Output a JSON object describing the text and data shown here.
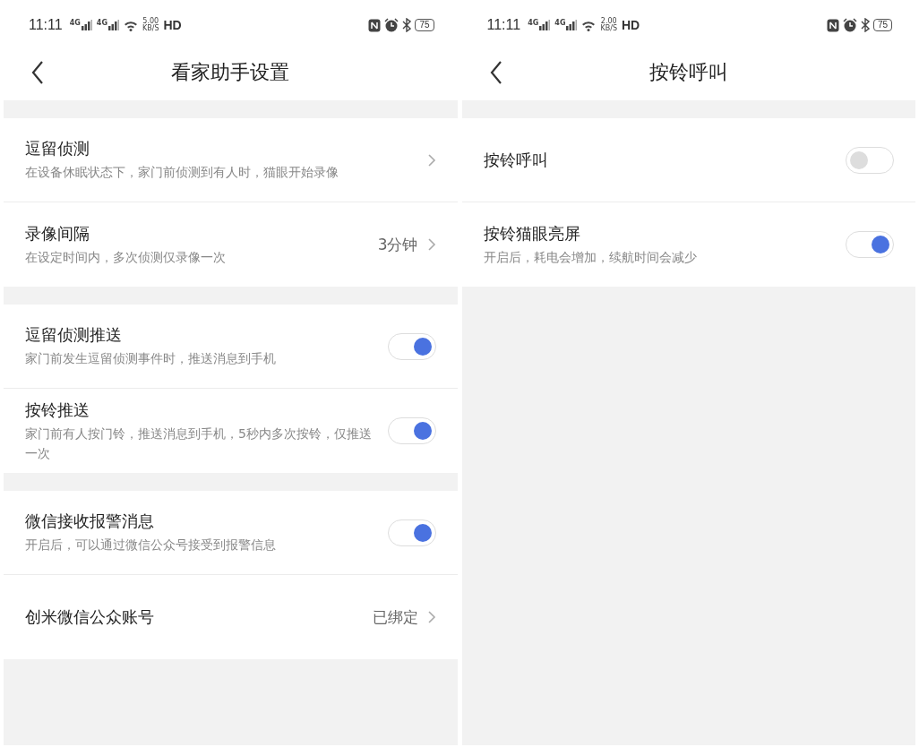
{
  "screens": [
    {
      "status_bar": {
        "time": "11:11",
        "signal_1": "4G",
        "signal_2": "4G",
        "speed": "5.00",
        "speed_unit": "KB/S",
        "hd": "HD",
        "battery": "75"
      },
      "title": "看家助手设置",
      "sections": [
        {
          "rows": [
            {
              "kind": "nav",
              "title": "逗留侦测",
              "subtitle": "在设备休眠状态下，家门前侦测到有人时，猫眼开始录像"
            },
            {
              "kind": "nav",
              "title": "录像间隔",
              "subtitle": "在设定时间内，多次侦测仅录像一次",
              "value": "3分钟"
            }
          ]
        },
        {
          "rows": [
            {
              "kind": "toggle",
              "title": "逗留侦测推送",
              "subtitle": "家门前发生逗留侦测事件时，推送消息到手机",
              "on": true
            },
            {
              "kind": "toggle",
              "title": "按铃推送",
              "subtitle": "家门前有人按门铃，推送消息到手机，5秒内多次按铃，仅推送一次",
              "on": true
            }
          ]
        },
        {
          "rows": [
            {
              "kind": "toggle",
              "title": "微信接收报警消息",
              "subtitle": "开启后，可以通过微信公众号接受到报警信息",
              "on": true
            },
            {
              "kind": "nav",
              "title": "创米微信公众账号",
              "value": "已绑定"
            }
          ]
        }
      ]
    },
    {
      "status_bar": {
        "time": "11:11",
        "signal_1": "4G",
        "signal_2": "4G",
        "speed": "2.00",
        "speed_unit": "KB/S",
        "hd": "HD",
        "battery": "75"
      },
      "title": "按铃呼叫",
      "sections": [
        {
          "rows": [
            {
              "kind": "toggle",
              "title": "按铃呼叫",
              "on": false
            },
            {
              "kind": "toggle",
              "title": "按铃猫眼亮屏",
              "subtitle": "开启后，耗电会增加，续航时间会减少",
              "on": true
            }
          ]
        }
      ]
    }
  ]
}
